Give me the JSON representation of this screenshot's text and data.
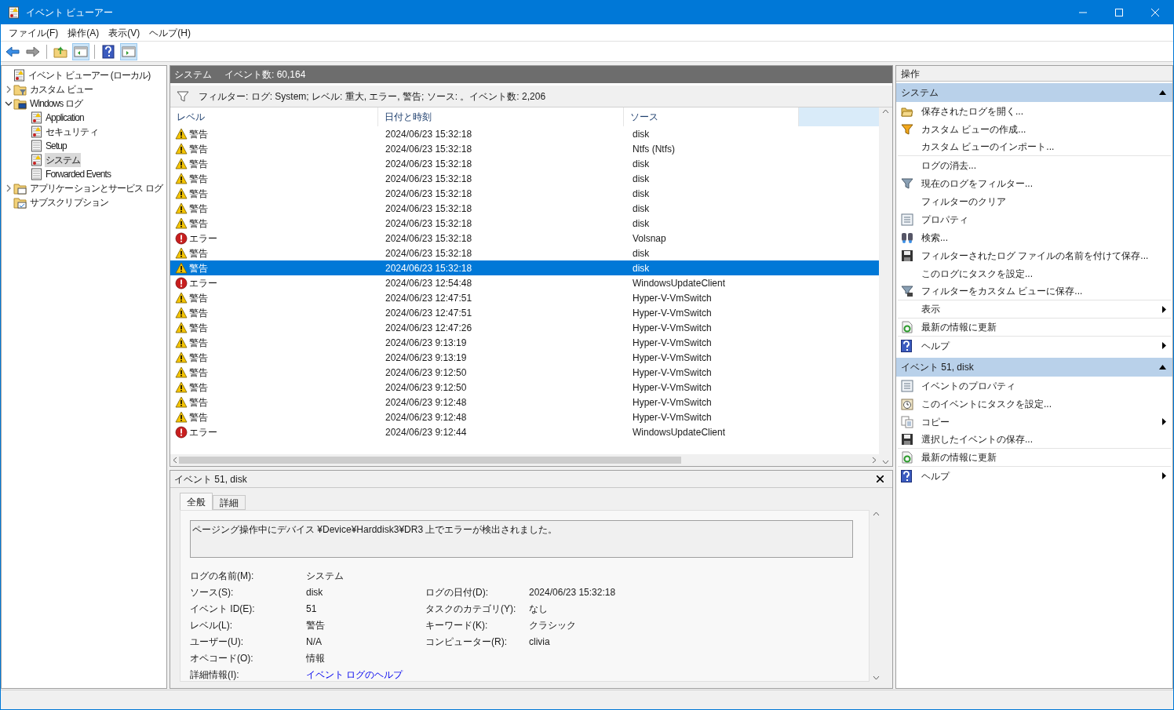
{
  "window": {
    "title": "イベント ビューアー"
  },
  "menu": [
    "ファイル(F)",
    "操作(A)",
    "表示(V)",
    "ヘルプ(H)"
  ],
  "toolbar_groups": [
    {
      "buttons": [
        {
          "kind": "back",
          "pressed": false
        },
        {
          "kind": "forward",
          "pressed": false
        }
      ]
    },
    {
      "buttons": [
        {
          "kind": "folder-up",
          "pressed": false
        },
        {
          "kind": "tree-pane",
          "pressed": true
        }
      ]
    },
    {
      "buttons": [
        {
          "kind": "help",
          "pressed": false
        },
        {
          "kind": "action-pane",
          "pressed": true
        }
      ]
    }
  ],
  "tree": [
    {
      "label": "イベント ビューアー (ローカル)",
      "kind": "viewer",
      "selected": false,
      "children": [
        {
          "label": "カスタム ビュー",
          "kind": "folder-filter",
          "expanded": false,
          "selected": false
        },
        {
          "label": "Windows ログ",
          "kind": "folder-pc",
          "expanded": true,
          "selected": false,
          "children": [
            {
              "label": "Application",
              "kind": "log-warn",
              "selected": false
            },
            {
              "label": "セキュリティ",
              "kind": "log-warn",
              "selected": false
            },
            {
              "label": "Setup",
              "kind": "log",
              "selected": false
            },
            {
              "label": "システム",
              "kind": "log-warn",
              "selected": true
            },
            {
              "label": "Forwarded Events",
              "kind": "log",
              "selected": false
            }
          ]
        },
        {
          "label": "アプリケーションとサービス ログ",
          "kind": "folder-win",
          "expanded": false,
          "selected": false
        },
        {
          "label": "サブスクリプション",
          "kind": "folder-sub",
          "selected": false
        }
      ]
    }
  ],
  "log_header": {
    "name": "システム",
    "count": "イベント数: 60,164"
  },
  "filter": "フィルター: ログ: System; レベル: 重大, エラー, 警告; ソース: 。イベント数: 2,206",
  "table": {
    "columns": [
      "レベル",
      "日付と時刻",
      "ソース"
    ],
    "rows": [
      {
        "kind": "warning",
        "level": "警告",
        "time": "2024/06/23 15:32:18",
        "source": "disk",
        "selected": false
      },
      {
        "kind": "warning",
        "level": "警告",
        "time": "2024/06/23 15:32:18",
        "source": "Ntfs (Ntfs)",
        "selected": false
      },
      {
        "kind": "warning",
        "level": "警告",
        "time": "2024/06/23 15:32:18",
        "source": "disk",
        "selected": false
      },
      {
        "kind": "warning",
        "level": "警告",
        "time": "2024/06/23 15:32:18",
        "source": "disk",
        "selected": false
      },
      {
        "kind": "warning",
        "level": "警告",
        "time": "2024/06/23 15:32:18",
        "source": "disk",
        "selected": false
      },
      {
        "kind": "warning",
        "level": "警告",
        "time": "2024/06/23 15:32:18",
        "source": "disk",
        "selected": false
      },
      {
        "kind": "warning",
        "level": "警告",
        "time": "2024/06/23 15:32:18",
        "source": "disk",
        "selected": false
      },
      {
        "kind": "error",
        "level": "エラー",
        "time": "2024/06/23 15:32:18",
        "source": "Volsnap",
        "selected": false
      },
      {
        "kind": "warning",
        "level": "警告",
        "time": "2024/06/23 15:32:18",
        "source": "disk",
        "selected": false
      },
      {
        "kind": "warning",
        "level": "警告",
        "time": "2024/06/23 15:32:18",
        "source": "disk",
        "selected": true
      },
      {
        "kind": "error",
        "level": "エラー",
        "time": "2024/06/23 12:54:48",
        "source": "WindowsUpdateClient",
        "selected": false
      },
      {
        "kind": "warning",
        "level": "警告",
        "time": "2024/06/23 12:47:51",
        "source": "Hyper-V-VmSwitch",
        "selected": false
      },
      {
        "kind": "warning",
        "level": "警告",
        "time": "2024/06/23 12:47:51",
        "source": "Hyper-V-VmSwitch",
        "selected": false
      },
      {
        "kind": "warning",
        "level": "警告",
        "time": "2024/06/23 12:47:26",
        "source": "Hyper-V-VmSwitch",
        "selected": false
      },
      {
        "kind": "warning",
        "level": "警告",
        "time": "2024/06/23 9:13:19",
        "source": "Hyper-V-VmSwitch",
        "selected": false
      },
      {
        "kind": "warning",
        "level": "警告",
        "time": "2024/06/23 9:13:19",
        "source": "Hyper-V-VmSwitch",
        "selected": false
      },
      {
        "kind": "warning",
        "level": "警告",
        "time": "2024/06/23 9:12:50",
        "source": "Hyper-V-VmSwitch",
        "selected": false
      },
      {
        "kind": "warning",
        "level": "警告",
        "time": "2024/06/23 9:12:50",
        "source": "Hyper-V-VmSwitch",
        "selected": false
      },
      {
        "kind": "warning",
        "level": "警告",
        "time": "2024/06/23 9:12:48",
        "source": "Hyper-V-VmSwitch",
        "selected": false
      },
      {
        "kind": "warning",
        "level": "警告",
        "time": "2024/06/23 9:12:48",
        "source": "Hyper-V-VmSwitch",
        "selected": false
      },
      {
        "kind": "error",
        "level": "エラー",
        "time": "2024/06/23 9:12:44",
        "source": "WindowsUpdateClient",
        "selected": false
      }
    ]
  },
  "detail": {
    "title": "イベント 51, disk",
    "tabs": [
      {
        "label": "全般",
        "selected": true
      },
      {
        "label": "詳細",
        "selected": false
      }
    ],
    "message": "ページング操作中にデバイス ¥Device¥Harddisk3¥DR3 上でエラーが検出されました。",
    "fields_left": [
      {
        "label": "ログの名前(M):",
        "value": "システム"
      },
      {
        "label": "ソース(S):",
        "value": "disk"
      },
      {
        "label": "イベント ID(E):",
        "value": "51"
      },
      {
        "label": "レベル(L):",
        "value": "警告"
      },
      {
        "label": "ユーザー(U):",
        "value": "N/A"
      },
      {
        "label": "オペコード(O):",
        "value": "情報"
      }
    ],
    "fields_right": [
      {
        "label": "ログの日付(D):",
        "value": "2024/06/23 15:32:18"
      },
      {
        "label": "タスクのカテゴリ(Y):",
        "value": "なし"
      },
      {
        "label": "キーワード(K):",
        "value": "クラシック"
      },
      {
        "label": "コンピューター(R):",
        "value": "clivia"
      }
    ],
    "more_info": {
      "label": "詳細情報(I):",
      "link": "イベント ログのヘルプ"
    }
  },
  "actions": {
    "title": "操作",
    "sections": [
      {
        "title": "システム",
        "expanded": true,
        "items": [
          {
            "label": "保存されたログを開く...",
            "kind": "folder",
            "submenu": false,
            "separator_after": false
          },
          {
            "label": "カスタム ビューの作成...",
            "kind": "funnel",
            "submenu": false,
            "separator_after": false
          },
          {
            "label": "カスタム ビューのインポート...",
            "kind": "plain",
            "submenu": false,
            "separator_after": true
          },
          {
            "label": "ログの消去...",
            "kind": "plain",
            "submenu": false,
            "separator_after": false
          },
          {
            "label": "現在のログをフィルター...",
            "kind": "funnel-gray",
            "submenu": false,
            "separator_after": false
          },
          {
            "label": "フィルターのクリア",
            "kind": "plain",
            "submenu": false,
            "separator_after": false
          },
          {
            "label": "プロパティ",
            "kind": "properties",
            "submenu": false,
            "separator_after": false
          },
          {
            "label": "検索...",
            "kind": "binoculars",
            "submenu": false,
            "separator_after": false
          },
          {
            "label": "フィルターされたログ ファイルの名前を付けて保存...",
            "kind": "floppy",
            "submenu": false,
            "separator_after": false
          },
          {
            "label": "このログにタスクを設定...",
            "kind": "plain",
            "submenu": false,
            "separator_after": false
          },
          {
            "label": "フィルターをカスタム ビューに保存...",
            "kind": "funnel-save",
            "submenu": false,
            "separator_after": true
          },
          {
            "label": "表示",
            "kind": "plain",
            "submenu": true,
            "separator_after": true
          },
          {
            "label": "最新の情報に更新",
            "kind": "refresh",
            "submenu": false,
            "separator_after": true
          },
          {
            "label": "ヘルプ",
            "kind": "help",
            "submenu": true,
            "separator_after": false
          }
        ]
      },
      {
        "title": "イベント 51, disk",
        "expanded": true,
        "items": [
          {
            "label": "イベントのプロパティ",
            "kind": "properties",
            "submenu": false,
            "separator_after": false
          },
          {
            "label": "このイベントにタスクを設定...",
            "kind": "clock",
            "submenu": false,
            "separator_after": false
          },
          {
            "label": "コピー",
            "kind": "copy",
            "submenu": true,
            "separator_after": false
          },
          {
            "label": "選択したイベントの保存...",
            "kind": "floppy",
            "submenu": false,
            "separator_after": true
          },
          {
            "label": "最新の情報に更新",
            "kind": "refresh",
            "submenu": false,
            "separator_after": true
          },
          {
            "label": "ヘルプ",
            "kind": "help",
            "submenu": true,
            "separator_after": false
          }
        ]
      }
    ]
  }
}
